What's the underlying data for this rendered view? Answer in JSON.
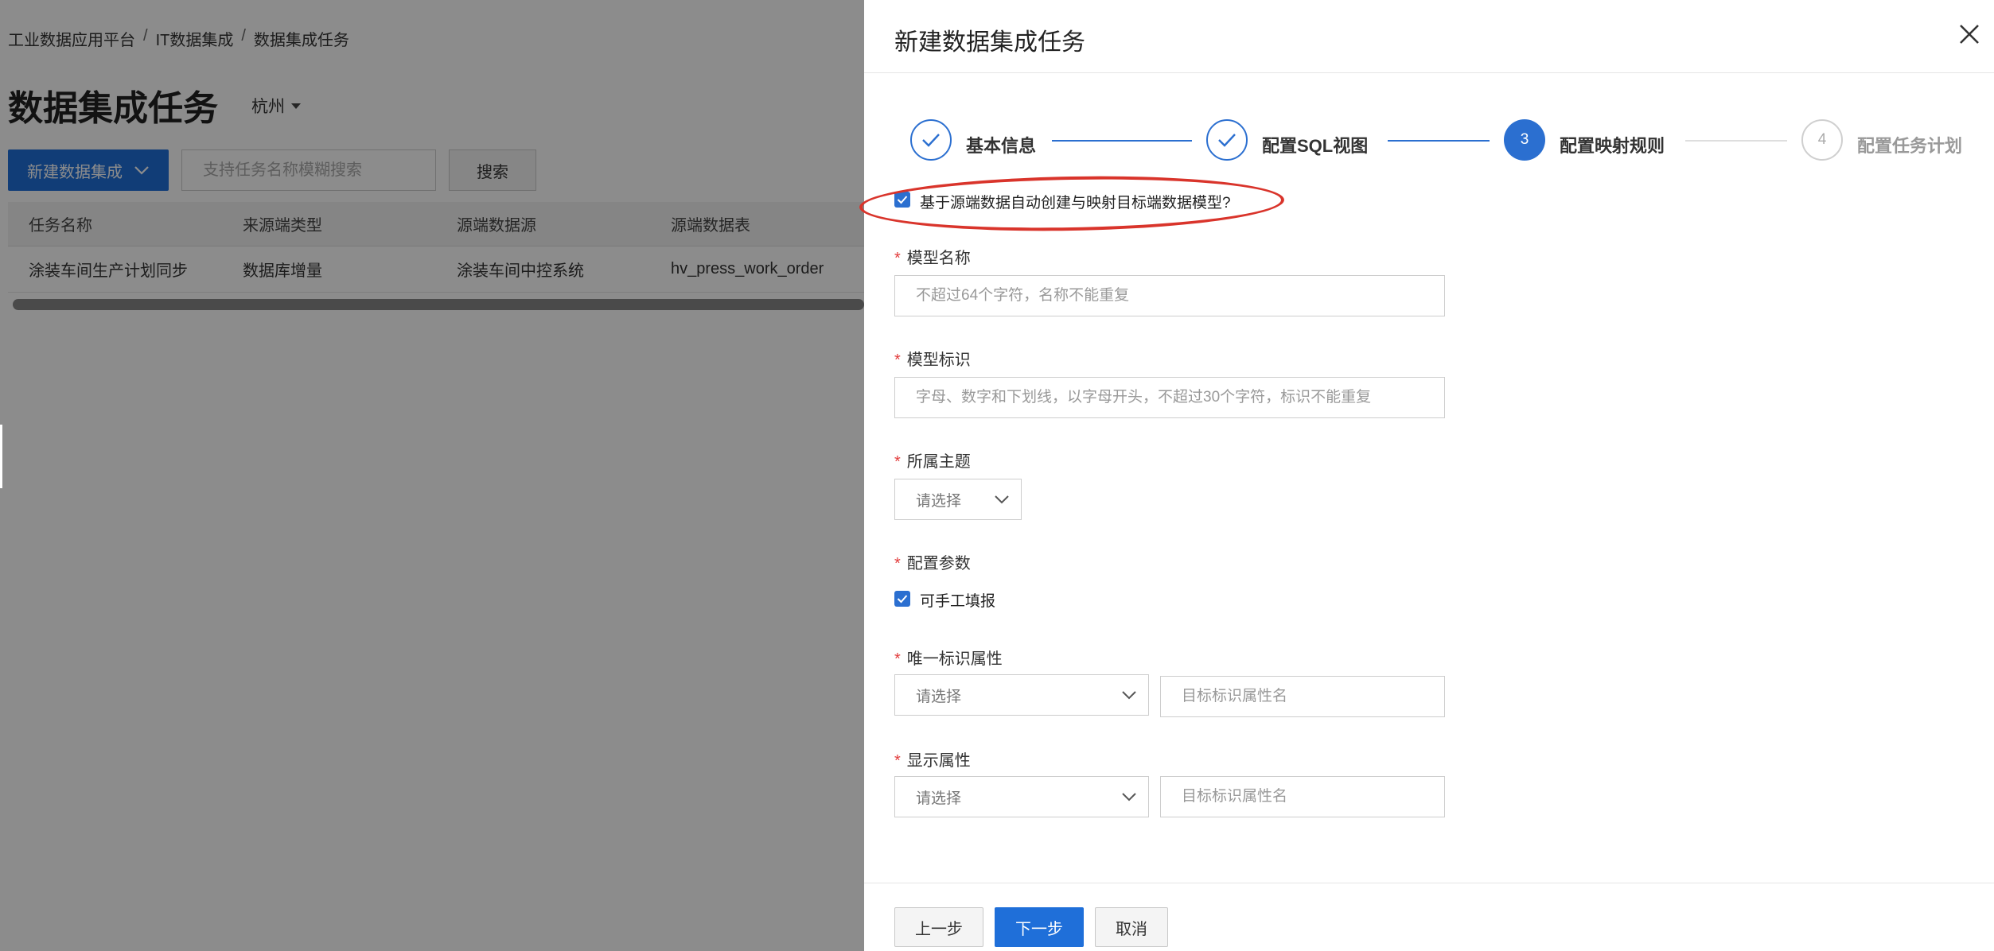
{
  "background": {
    "breadcrumb": [
      "工业数据应用平台",
      "IT数据集成",
      "数据集成任务"
    ],
    "breadcrumb_separator": "/",
    "page_title": "数据集成任务",
    "region": "杭州",
    "new_button_label": "新建数据集成",
    "search_placeholder": "支持任务名称模糊搜索",
    "search_button_label": "搜索",
    "table": {
      "columns": [
        "任务名称",
        "来源端类型",
        "源端数据源",
        "源端数据表"
      ],
      "rows": [
        [
          "涂装车间生产计划同步",
          "数据库增量",
          "涂装车间中控系统",
          "hv_press_work_order"
        ]
      ]
    }
  },
  "drawer": {
    "title": "新建数据集成任务",
    "steps": [
      {
        "label": "基本信息",
        "status": "done"
      },
      {
        "label": "配置SQL视图",
        "status": "done"
      },
      {
        "number": "3",
        "label": "配置映射规则",
        "status": "active"
      },
      {
        "number": "4",
        "label": "配置任务计划",
        "status": "todo"
      }
    ],
    "auto_create_checkbox_label": "基于源端数据自动创建与映射目标端数据模型?",
    "fields": {
      "model_name": {
        "label": "模型名称",
        "placeholder": "不超过64个字符，名称不能重复"
      },
      "model_id": {
        "label": "模型标识",
        "placeholder": "字母、数字和下划线，以字母开头，不超过30个字符，标识不能重复"
      },
      "topic": {
        "label": "所属主题",
        "select_placeholder": "请选择"
      },
      "config_params": {
        "label": "配置参数",
        "checkbox_label": "可手工填报"
      },
      "unique_attr": {
        "label": "唯一标识属性",
        "select_placeholder": "请选择",
        "input_placeholder": "目标标识属性名"
      },
      "display_attr": {
        "label": "显示属性",
        "select_placeholder": "请选择",
        "input_placeholder": "目标标识属性名"
      }
    },
    "required_mark": "*",
    "footer": {
      "prev_label": "上一步",
      "next_label": "下一步",
      "cancel_label": "取消"
    }
  },
  "colors": {
    "primary": "#1f6fd9",
    "required": "#e23c3c",
    "annotation": "#d9342b"
  }
}
